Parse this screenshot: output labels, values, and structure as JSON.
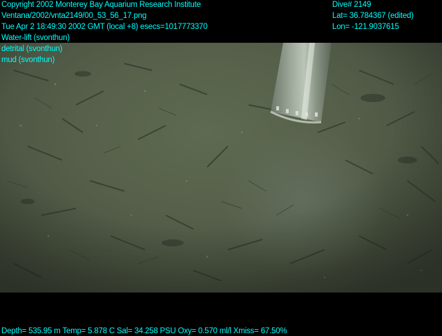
{
  "overlay": {
    "copyright": "Copyright 2002 Monterey Bay Aquarium Research Institute",
    "file_path": "Ventana/2002/vnta2149/00_53_56_17.png",
    "timestamp": "Tue Apr  2 18:49:30 2002 GMT (local +8)  esecs=1017773370",
    "annotations": [
      "Water-lift (svonthun)",
      "detrital (svonthun)",
      "mud (svonthun)"
    ],
    "dive": "Dive# 2149",
    "latitude": "Lat= 36.784367 (edited)",
    "longitude": "Lon= -121.9037615",
    "telemetry": "Depth= 535.95 m  Temp= 5.878 C  Sal= 34.258 PSU  Oxy= 0.570 ml/l  Xmiss= 67.50%"
  },
  "colors": {
    "overlay_text": "#00ffff",
    "background": "#000000",
    "seafloor": "#56604a"
  }
}
